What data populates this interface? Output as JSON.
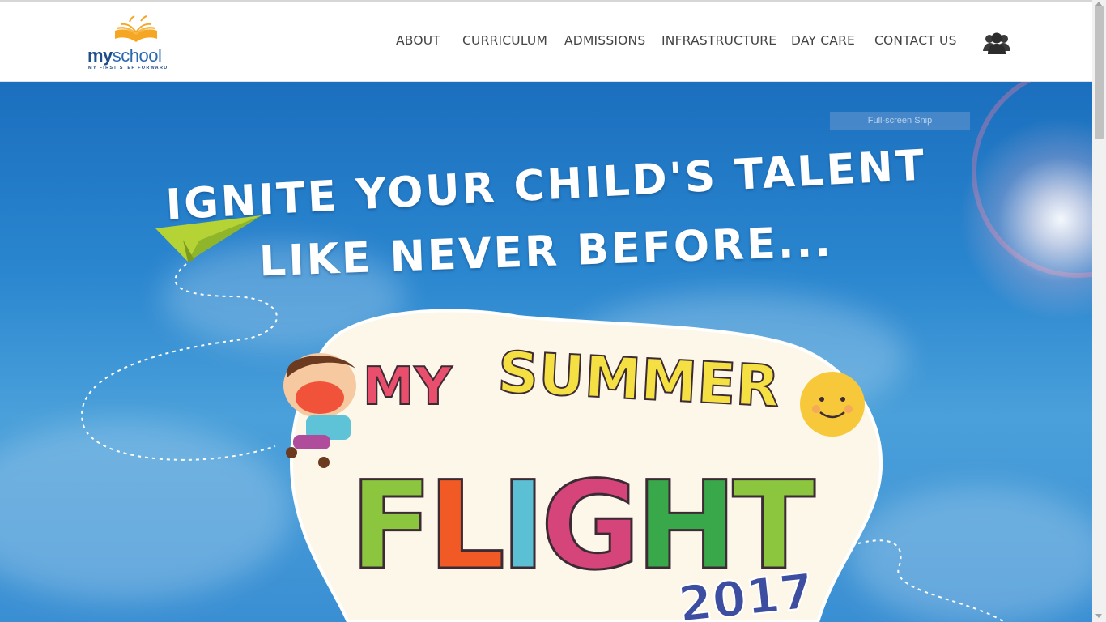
{
  "brand": {
    "name_part1": "my",
    "name_part2": "school",
    "tagline": "MY FIRST STEP FORWARD",
    "primary_color": "#1f4e8a",
    "accent_color": "#f5a623"
  },
  "nav": {
    "items": [
      {
        "label": "ABOUT"
      },
      {
        "label": "CURRICULUM"
      },
      {
        "label": "ADMISSIONS"
      },
      {
        "label": "INFRASTRUCTURE"
      },
      {
        "label": "DAY CARE"
      },
      {
        "label": "CONTACT US"
      }
    ],
    "user_icon": "users-icon"
  },
  "hero": {
    "headline_line1": "IGNITE YOUR CHILD'S TALENT",
    "headline_line2": "LIKE NEVER BEFORE...",
    "campaign_word1": "MY",
    "campaign_word2": "SUMMER",
    "campaign_word3": "FLIGHT",
    "campaign_year": "2017",
    "sky_color": "#2a86cf",
    "overlay_label": "Full-screen Snip"
  }
}
